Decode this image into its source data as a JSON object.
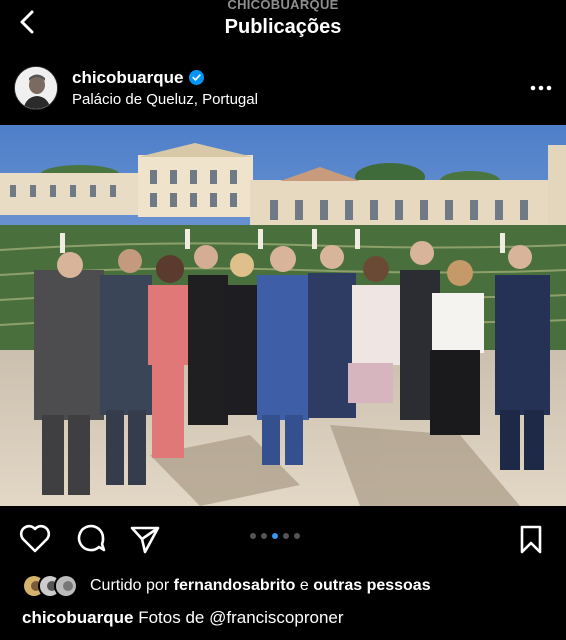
{
  "header": {
    "account_label": "CHICOBUARQUE",
    "title": "Publicações"
  },
  "post": {
    "username": "chicobuarque",
    "location": "Palácio de Queluz, Portugal",
    "icons": {
      "back": "chevron-left-icon",
      "verified": "verified-badge-icon",
      "more": "more-horizontal-icon",
      "like": "heart-icon",
      "comment": "comment-icon",
      "share": "send-icon",
      "save": "bookmark-icon"
    },
    "carousel": {
      "count": 5,
      "active_index": 2
    },
    "likes": {
      "prefix": "Curtido por",
      "user": "fernandosabrito",
      "connector": "e",
      "others": "outras pessoas"
    },
    "caption": {
      "username": "chicobuarque",
      "text_before": "Fotos de",
      "mention": "@franciscoproner"
    }
  },
  "colors": {
    "background": "#000000",
    "accent_blue": "#3897f0",
    "verified_blue": "#0095f6"
  }
}
